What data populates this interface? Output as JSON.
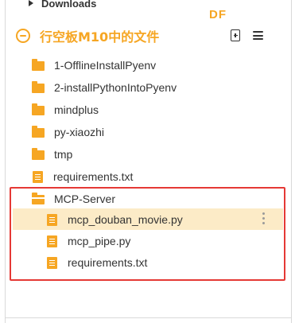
{
  "tree_above": {
    "label": "Downloads"
  },
  "watermark": {
    "text": "DF"
  },
  "panel": {
    "title": "行空板M10中的文件"
  },
  "items": [
    {
      "type": "folder",
      "label": "1-OfflineInstallPyenv"
    },
    {
      "type": "folder",
      "label": "2-installPythonIntoPyenv"
    },
    {
      "type": "folder",
      "label": "mindplus"
    },
    {
      "type": "folder",
      "label": "py-xiaozhi"
    },
    {
      "type": "folder",
      "label": "tmp"
    },
    {
      "type": "file",
      "label": "requirements.txt"
    },
    {
      "type": "folder-open",
      "label": "MCP-Server",
      "children": [
        {
          "type": "file",
          "label": "mcp_douban_movie.py",
          "selected": true
        },
        {
          "type": "file",
          "label": "mcp_pipe.py"
        },
        {
          "type": "file",
          "label": "requirements.txt"
        }
      ]
    }
  ],
  "colors": {
    "accent": "#f6a623",
    "selection": "#fcebc7",
    "annotation_box": "#e53935",
    "text": "#333333"
  },
  "icons": {
    "add_file": "add-file-icon",
    "menu": "menu-icon",
    "more": "more-vertical-icon",
    "folder": "folder-icon",
    "file": "file-icon"
  }
}
